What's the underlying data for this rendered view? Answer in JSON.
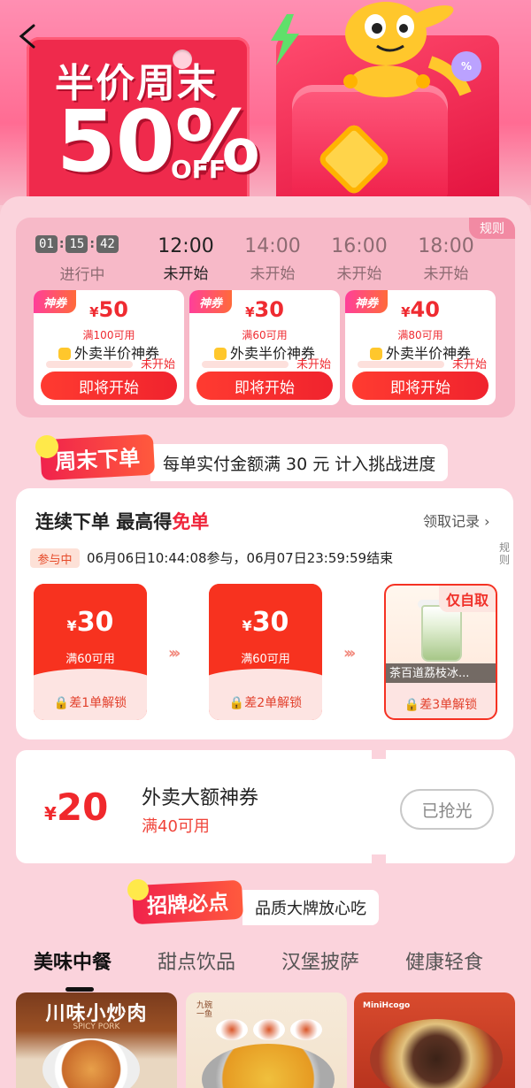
{
  "colors": {
    "accent": "#f0243a",
    "page_bg": "#fbd3dc",
    "button": "#f7321f"
  },
  "hero": {
    "back_icon": "back-arrow-icon",
    "title": "半价周末",
    "percent": "50%",
    "off": "OFF",
    "badge": "%"
  },
  "sessions": {
    "rules_label": "规则",
    "countdown": {
      "h": "01",
      "m": "15",
      "s": "42"
    },
    "slots": [
      {
        "time": "",
        "status": "进行中"
      },
      {
        "time": "12:00",
        "status": "未开始"
      },
      {
        "time": "14:00",
        "status": "未开始"
      },
      {
        "time": "16:00",
        "status": "未开始"
      },
      {
        "time": "18:00",
        "status": "未开始"
      }
    ],
    "coupons": [
      {
        "tag": "神券",
        "currency": "¥",
        "amount": "50",
        "condition": "满100可用",
        "name": "外卖半价神券",
        "status": "未开始",
        "button": "即将开始"
      },
      {
        "tag": "神券",
        "currency": "¥",
        "amount": "30",
        "condition": "满60可用",
        "name": "外卖半价神券",
        "status": "未开始",
        "button": "即将开始"
      },
      {
        "tag": "神券",
        "currency": "¥",
        "amount": "40",
        "condition": "满80可用",
        "name": "外卖半价神券",
        "status": "未开始",
        "button": "即将开始"
      }
    ]
  },
  "weekend": {
    "label": "周末下单",
    "text": "每单实付金额满 30 元 计入挑战进度"
  },
  "challenge": {
    "title_prefix": "连续下单 最高得",
    "title_highlight": "免单",
    "record_label": "领取记录 ›",
    "rules_label": "规则",
    "status_badge": "参与中",
    "time_text": "06月06日10:44:08参与，06月07日23:59:59结束",
    "steps": [
      {
        "currency": "¥",
        "value": "30",
        "condition": "满60可用",
        "lock_text": "差1单解锁"
      },
      {
        "currency": "¥",
        "value": "30",
        "condition": "满60可用",
        "lock_text": "差2单解锁"
      },
      {
        "tag": "仅自取",
        "product_name": "茶百道荔枝冰...",
        "lock_text": "差3单解锁"
      }
    ]
  },
  "big_coupon": {
    "currency": "¥",
    "value": "20",
    "name": "外卖大额神券",
    "condition": "满40可用",
    "button": "已抢光"
  },
  "brand": {
    "label": "招牌必点",
    "text": "品质大牌放心吃"
  },
  "tabs": [
    "美味中餐",
    "甜点饮品",
    "汉堡披萨",
    "健康轻食"
  ],
  "shops": [
    {
      "title": "川味小炒肉",
      "subtitle": "SPICY PORK"
    },
    {
      "seal": "九碗一鱼"
    },
    {
      "logo": "MiniHcogo"
    }
  ]
}
